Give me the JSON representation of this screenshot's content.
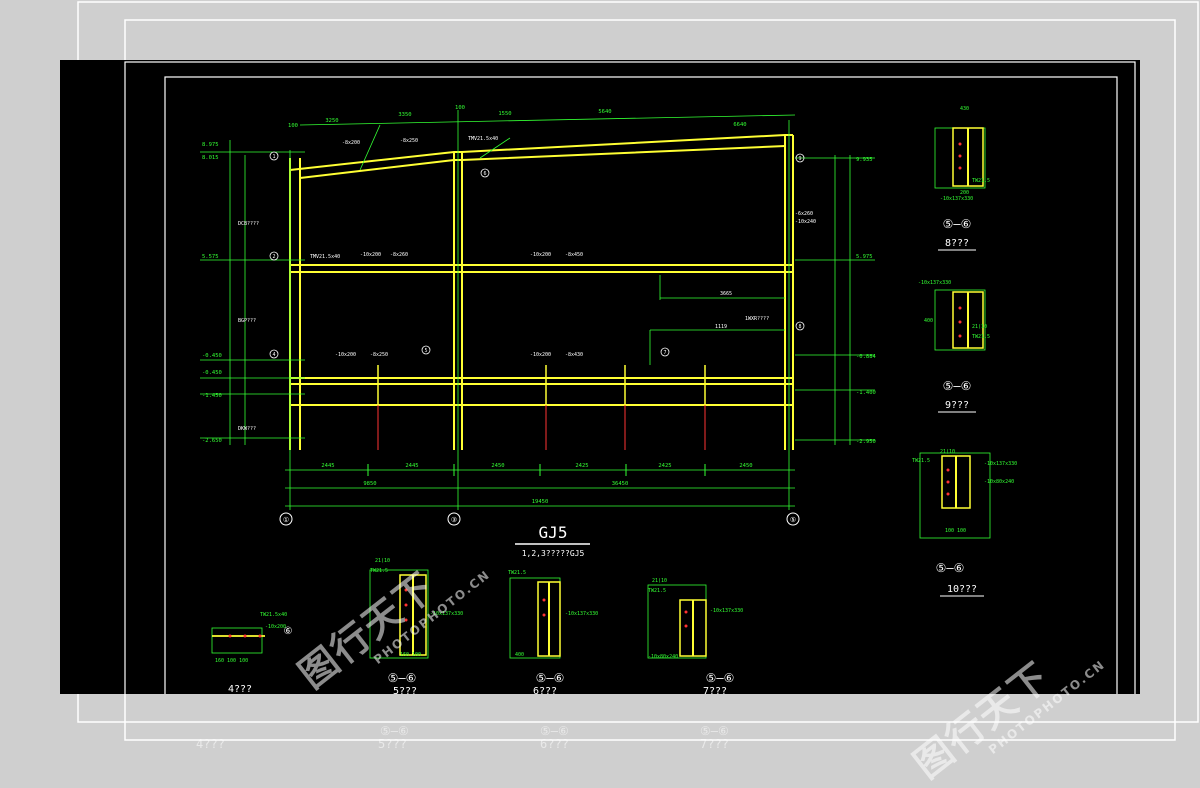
{
  "drawing": {
    "title": "GJ5",
    "subtitle": "1,2,3?????GJ5",
    "axis_bubbles": [
      "①",
      "③",
      "⑤"
    ],
    "top_dims": [
      "100",
      "3250",
      "3350",
      "100",
      "1550",
      "5640",
      "6640"
    ],
    "bottom_dims": [
      "2445",
      "2445",
      "2450",
      "2425",
      "2425",
      "2450"
    ],
    "overall_dims": [
      "9850",
      "36450",
      "19450"
    ],
    "elevations_left": [
      "8.975",
      "8.015",
      "5.575",
      "-0.450",
      "-0.450",
      "-1.450",
      "-2.650"
    ],
    "elevations_right": [
      "9.935",
      "5.975",
      "-0.884",
      "-1.400",
      "-2.950"
    ],
    "member_labels": [
      "-8x200",
      "-8x250",
      "-10x200",
      "-8x260",
      "-10x200",
      "-8x450",
      "-10x200",
      "-8x250",
      "-10x200",
      "-8x430",
      "TMV21.5x40",
      "TMV21.5x40",
      "-6x260",
      "-10x240"
    ],
    "left_notes": [
      "DCB????",
      "BGP???",
      "DKW???"
    ],
    "right_notes": [
      "1WXR????",
      "3665",
      "1119"
    ],
    "grid_marks": [
      "1",
      "2",
      "4",
      "5",
      "6",
      "7",
      "8",
      "9"
    ]
  },
  "details": [
    {
      "label": "8???",
      "sect": "⑤—⑥",
      "notes": [
        "430",
        "TW21.5",
        "-10x137x330",
        "200"
      ]
    },
    {
      "label": "9???",
      "sect": "⑤—⑥",
      "notes": [
        "-10x137x330",
        "21(10",
        "TW21.5",
        "400"
      ]
    },
    {
      "label": "10???",
      "sect": "⑤—⑥",
      "notes": [
        "21(10",
        "TW21.5",
        "-10x137x330",
        "-10x80x240",
        "100 100"
      ]
    },
    {
      "label": "4???",
      "sect": "⑥",
      "notes": [
        "-10x200",
        "TW21.5x40",
        "160 100 100"
      ]
    },
    {
      "label": "5???",
      "sect": "⑤—⑥",
      "notes": [
        "21(10",
        "TW21.5",
        "-10x137x330",
        "160 100"
      ]
    },
    {
      "label": "6???",
      "sect": "⑤—⑥",
      "notes": [
        "TW21.5",
        "-10x137x330",
        "400"
      ]
    },
    {
      "label": "7???",
      "sect": "⑤—⑥",
      "notes": [
        "21(10",
        "TW21.5",
        "-10x137x330",
        "-10x80x240"
      ]
    }
  ],
  "watermark": {
    "logo": "图行天下",
    "url": "PHOTOPHOTO.CN"
  },
  "colors": {
    "background": "#000000",
    "frame": "#ffffff",
    "member": "#ffff33",
    "dimension": "#33ff33",
    "text": "#ffffff",
    "bolt": "#ff3333",
    "cyan": "#33cccc"
  }
}
